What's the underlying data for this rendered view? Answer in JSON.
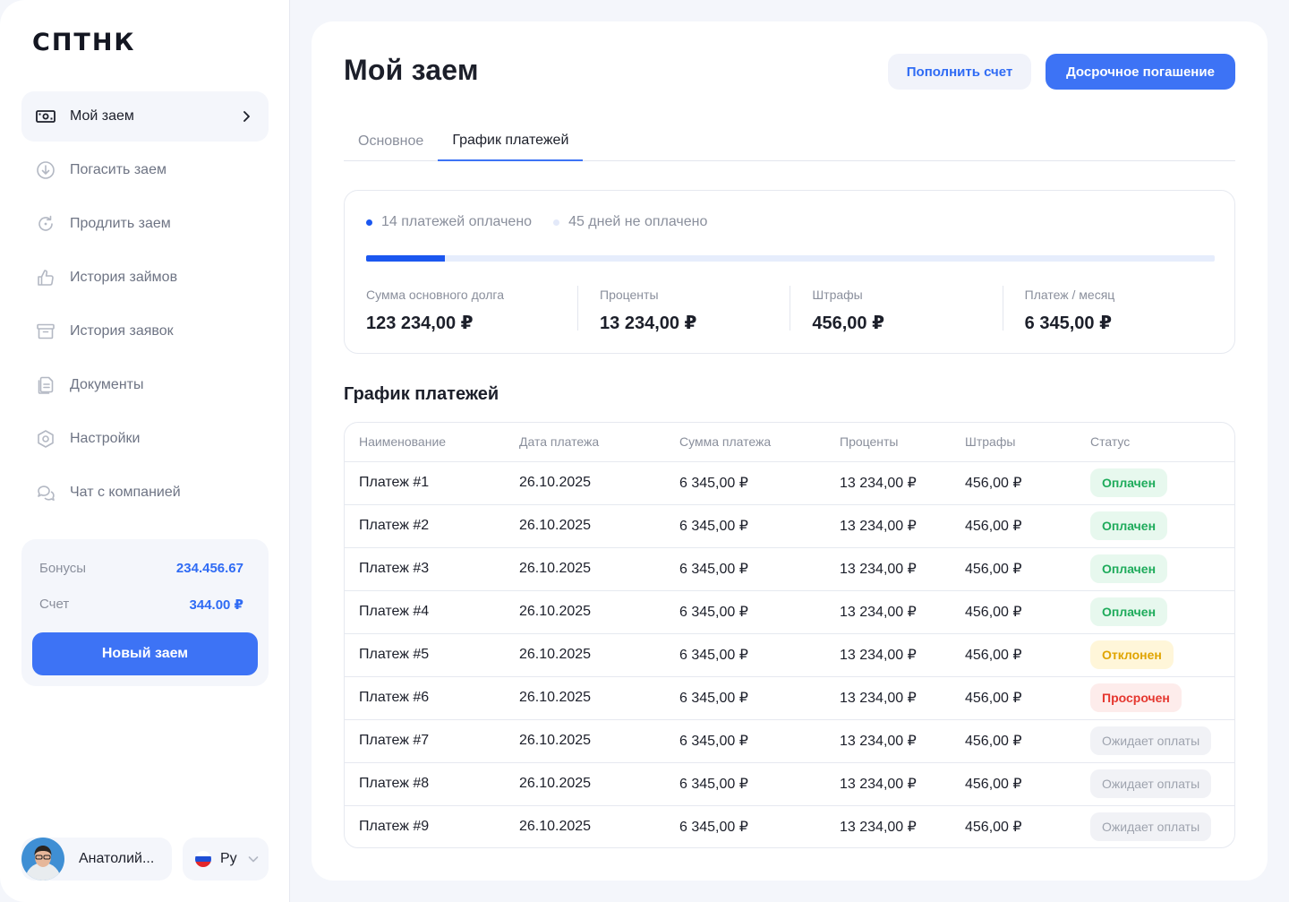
{
  "sidebar": {
    "logo": "СПТНК",
    "nav": [
      {
        "label": "Мой заем",
        "icon": "banknote-icon",
        "active": true
      },
      {
        "label": "Погасить заем",
        "icon": "arrow-down-circle-icon"
      },
      {
        "label": "Продлить заем",
        "icon": "refresh-icon"
      },
      {
        "label": "История займов",
        "icon": "thumbs-up-icon"
      },
      {
        "label": "История заявок",
        "icon": "archive-icon"
      },
      {
        "label": "Документы",
        "icon": "documents-icon"
      },
      {
        "label": "Настройки",
        "icon": "settings-hexagon-icon"
      },
      {
        "label": "Чат с компанией",
        "icon": "chat-icon"
      }
    ],
    "wallet": {
      "bonus_label": "Бонусы",
      "bonus_value": "234.456.67",
      "account_label": "Счет",
      "account_value": "344.00 ₽",
      "new_loan_label": "Новый заем"
    },
    "user": {
      "name": "Анатолий..."
    },
    "language": {
      "label": "Ру"
    }
  },
  "main": {
    "title": "Мой заем",
    "topup_label": "Пополнить счет",
    "early_label": "Досрочное погашение",
    "tabs": [
      {
        "label": "Основное",
        "active": false
      },
      {
        "label": "График платежей",
        "active": true
      }
    ],
    "summary": {
      "paid_label": "14 платежей оплачено",
      "unpaid_label": "45 дней не оплачено",
      "progress_percent": 9.3,
      "colors": {
        "paid": "#1b57f0",
        "unpaid": "#e6edfc"
      },
      "stats": [
        {
          "label": "Сумма основного долга",
          "value": "123 234,00 ₽"
        },
        {
          "label": "Проценты",
          "value": "13 234,00 ₽"
        },
        {
          "label": "Штрафы",
          "value": "456,00 ₽"
        },
        {
          "label": "Платеж / месяц",
          "value": "6 345,00 ₽"
        }
      ]
    },
    "schedule": {
      "title": "График платежей",
      "columns": [
        "Наименование",
        "Дата платежа",
        "Сумма платежа",
        "Проценты",
        "Штрафы",
        "Статус"
      ],
      "rows": [
        {
          "name": "Платеж #1",
          "date": "26.10.2025",
          "amount": "6 345,00 ₽",
          "interest": "13 234,00 ₽",
          "fine": "456,00 ₽",
          "status": "Оплачен",
          "status_type": "paid"
        },
        {
          "name": "Платеж #2",
          "date": "26.10.2025",
          "amount": "6 345,00 ₽",
          "interest": "13 234,00 ₽",
          "fine": "456,00 ₽",
          "status": "Оплачен",
          "status_type": "paid"
        },
        {
          "name": "Платеж #3",
          "date": "26.10.2025",
          "amount": "6 345,00 ₽",
          "interest": "13 234,00 ₽",
          "fine": "456,00 ₽",
          "status": "Оплачен",
          "status_type": "paid"
        },
        {
          "name": "Платеж #4",
          "date": "26.10.2025",
          "amount": "6 345,00 ₽",
          "interest": "13 234,00 ₽",
          "fine": "456,00 ₽",
          "status": "Оплачен",
          "status_type": "paid"
        },
        {
          "name": "Платеж #5",
          "date": "26.10.2025",
          "amount": "6 345,00 ₽",
          "interest": "13 234,00 ₽",
          "fine": "456,00 ₽",
          "status": "Отклонен",
          "status_type": "rejected"
        },
        {
          "name": "Платеж #6",
          "date": "26.10.2025",
          "amount": "6 345,00 ₽",
          "interest": "13 234,00 ₽",
          "fine": "456,00 ₽",
          "status": "Просрочен",
          "status_type": "overdue"
        },
        {
          "name": "Платеж #7",
          "date": "26.10.2025",
          "amount": "6 345,00 ₽",
          "interest": "13 234,00 ₽",
          "fine": "456,00 ₽",
          "status": "Ожидает оплаты",
          "status_type": "pending"
        },
        {
          "name": "Платеж #8",
          "date": "26.10.2025",
          "amount": "6 345,00 ₽",
          "interest": "13 234,00 ₽",
          "fine": "456,00 ₽",
          "status": "Ожидает оплаты",
          "status_type": "pending"
        },
        {
          "name": "Платеж #9",
          "date": "26.10.2025",
          "amount": "6 345,00 ₽",
          "interest": "13 234,00 ₽",
          "fine": "456,00 ₽",
          "status": "Ожидает оплаты",
          "status_type": "pending"
        }
      ]
    }
  },
  "colors": {
    "accent": "#3d73f5",
    "paid": "#1eab5b",
    "rejected": "#e0a400",
    "overdue": "#e5372f",
    "pending": "#9ea3ae"
  }
}
